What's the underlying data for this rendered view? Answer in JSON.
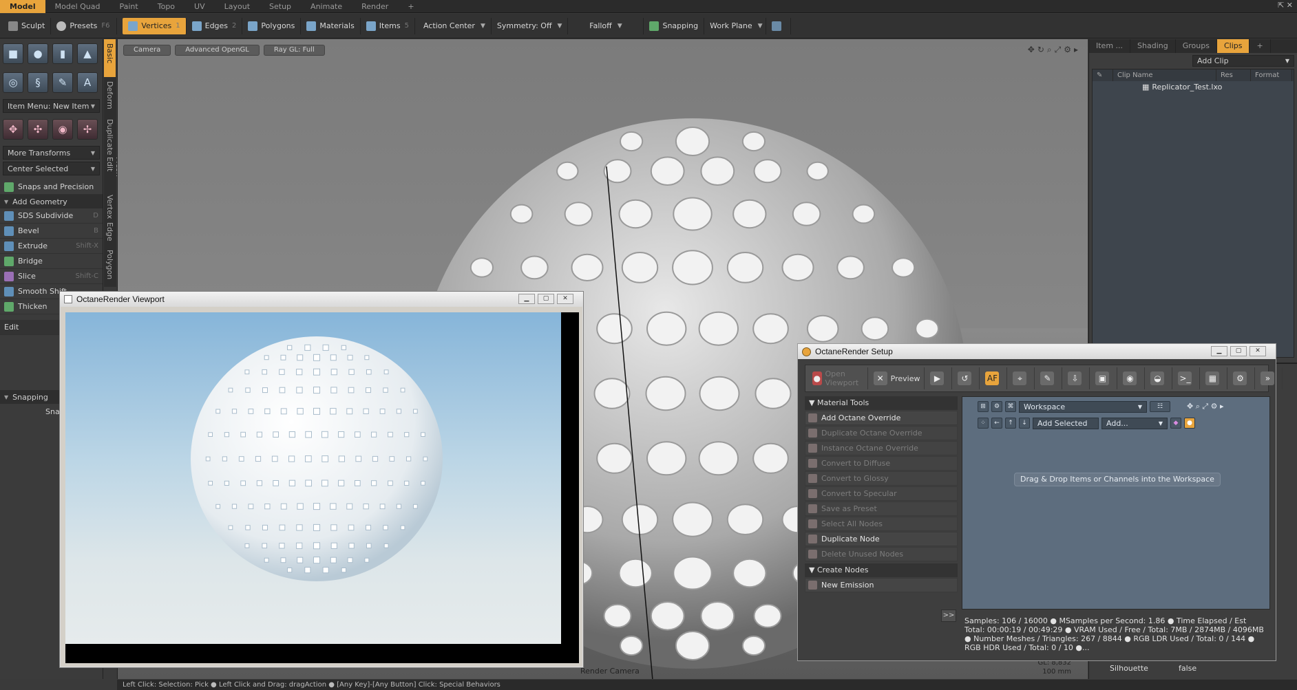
{
  "modeTabs": [
    "Model",
    "Model Quad",
    "Paint",
    "Topo",
    "UV",
    "Layout",
    "Setup",
    "Animate",
    "Render",
    "+"
  ],
  "toolbar": {
    "sculpt": "Sculpt",
    "presets": "Presets",
    "presets_key": "F6",
    "vertices": "Vertices",
    "vertices_num": "1",
    "edges": "Edges",
    "edges_num": "2",
    "polygons": "Polygons",
    "materials": "Materials",
    "items": "Items",
    "items_num": "5",
    "action_center": "Action Center",
    "symmetry": "Symmetry: Off",
    "falloff": "Falloff",
    "snapping": "Snapping",
    "work_plane": "Work Plane"
  },
  "left": {
    "item_menu": "Item Menu: New Item",
    "more_transforms": "More Transforms",
    "center_selected": "Center Selected",
    "snaps_precision": "Snaps and Precision",
    "add_geometry": "Add Geometry",
    "tools": [
      {
        "label": "SDS Subdivide",
        "key": "D"
      },
      {
        "label": "Bevel",
        "key": "B"
      },
      {
        "label": "Extrude",
        "key": "Shift-X"
      },
      {
        "label": "Bridge",
        "key": ""
      },
      {
        "label": "Slice",
        "key": "Shift-C"
      },
      {
        "label": "Smooth Shift",
        "key": ""
      },
      {
        "label": "Thicken",
        "key": ""
      }
    ],
    "edit": "Edit",
    "snapping": "Snapping",
    "snap_btn": "Snap"
  },
  "vtabs": [
    "Basic",
    "Deform",
    "Duplicate",
    "Mesh Edit",
    "Vertex",
    "Edge",
    "Polygon"
  ],
  "viewport": {
    "camera": "Camera",
    "shading": "Advanced OpenGL",
    "raygl": "Ray GL: Full",
    "render_camera": "Render Camera",
    "gl_info": "GL: 8,832",
    "scale": "100 mm"
  },
  "right": {
    "tabs": [
      "Item ...",
      "Shading",
      "Groups",
      "Clips",
      "+"
    ],
    "add_clip": "Add Clip",
    "col_clip_name": "Clip Name",
    "col_res": "Res",
    "col_format": "Format",
    "clip_file": "Replicator_Test.lxo",
    "prop_name": "Silhouette",
    "prop_value": "false"
  },
  "octViewport": {
    "title": "OctaneRender Viewport"
  },
  "octSetup": {
    "title": "OctaneRender Setup",
    "open_viewport": "Open Viewport",
    "preview": "Preview",
    "material_tools": "Material Tools",
    "items": [
      {
        "label": "Add Octane Override",
        "enabled": true
      },
      {
        "label": "Duplicate Octane Override",
        "enabled": false
      },
      {
        "label": "Instance Octane Override",
        "enabled": false
      },
      {
        "label": "Convert to Diffuse",
        "enabled": false
      },
      {
        "label": "Convert to Glossy",
        "enabled": false
      },
      {
        "label": "Convert to Specular",
        "enabled": false
      },
      {
        "label": "Save as Preset",
        "enabled": false
      },
      {
        "label": "Select All Nodes",
        "enabled": false
      },
      {
        "label": "Duplicate Node",
        "enabled": true
      },
      {
        "label": "Delete Unused Nodes",
        "enabled": false
      }
    ],
    "create_nodes": "Create Nodes",
    "new_emission": "New Emission",
    "more": ">>",
    "workspace": "Workspace",
    "add_selected": "Add Selected",
    "add": "Add...",
    "drop_hint": "Drag & Drop Items or Channels into the Workspace",
    "stats": "Samples: 106  / 16000 ● MSamples per Second: 1.86 ● Time Elapsed / Est Total: 00:00:19 / 00:49:29 ● VRAM Used / Free / Total: 7MB / 2874MB / 4096MB ● Number Meshes / Triangles: 267 / 8844 ● RGB LDR Used / Total: 0 / 144 ● RGB HDR Used / Total: 0 / 10 ●..."
  },
  "status": "Left Click: Selection: Pick ● Left Click and Drag: dragAction ● [Any Key]-[Any Button] Click: Special Behaviors"
}
